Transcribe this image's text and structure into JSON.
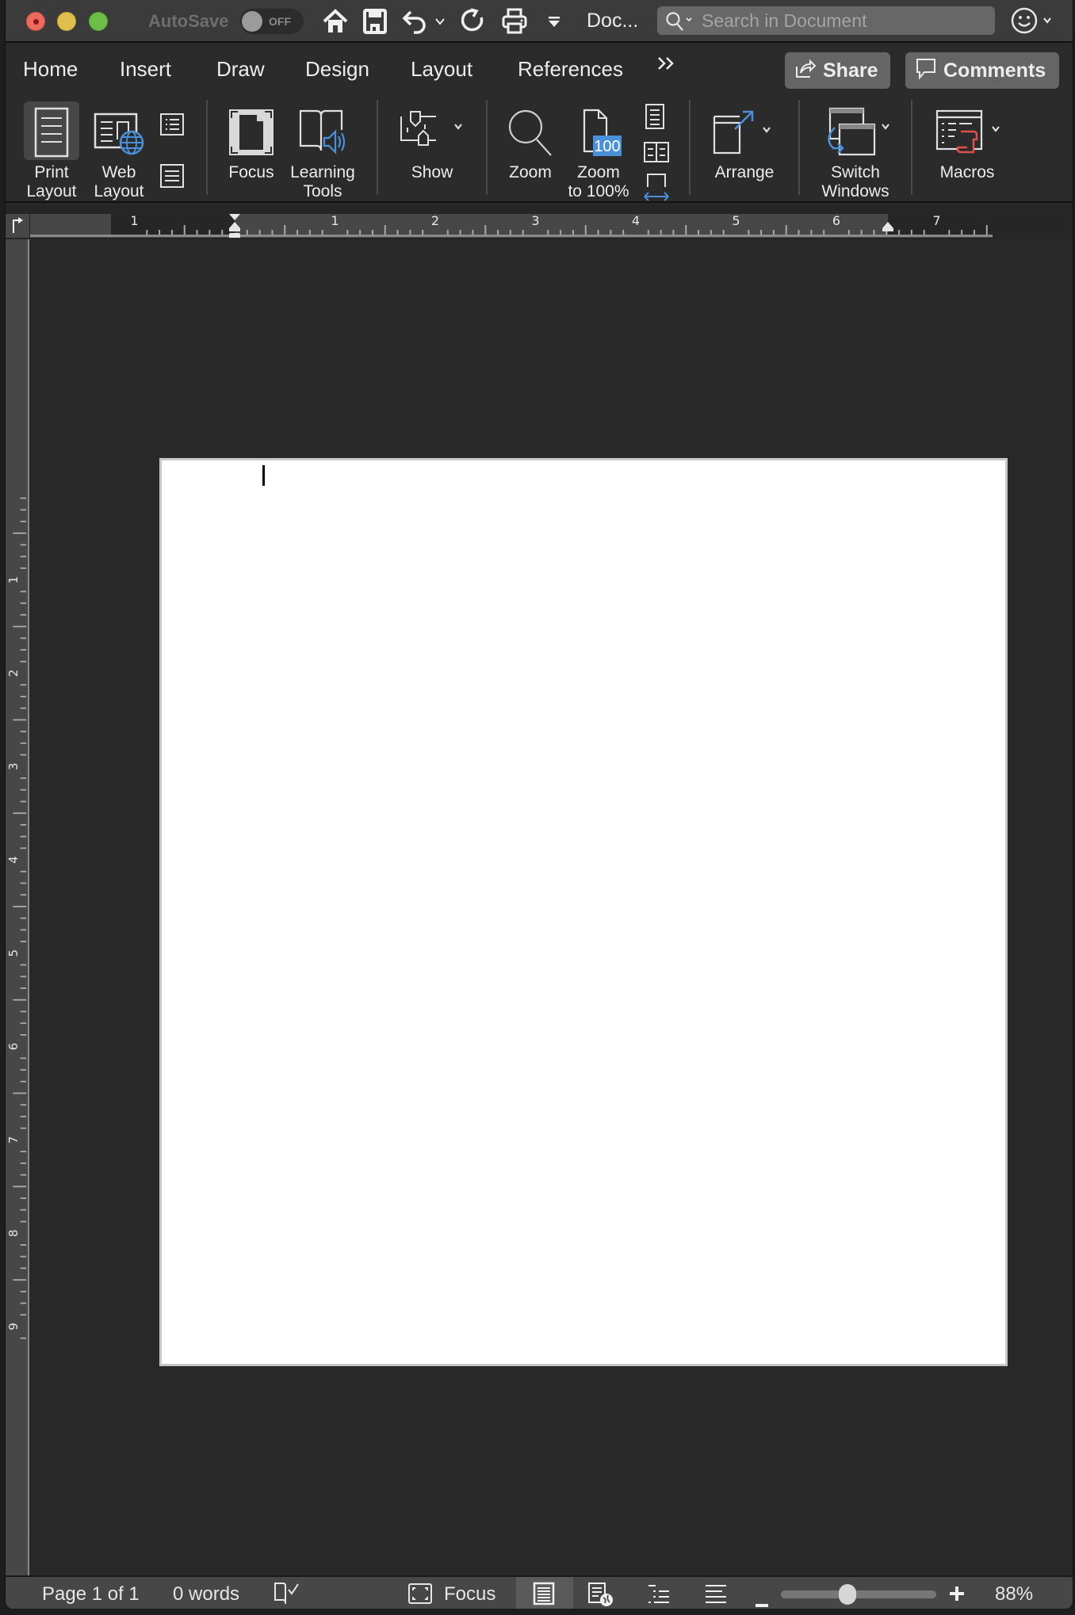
{
  "titlebar": {
    "autosave_label": "AutoSave",
    "autosave_state": "OFF",
    "doc_title": "Doc...",
    "search_placeholder": "Search in Document",
    "icons": [
      "home-icon",
      "save-icon",
      "undo-icon",
      "undo-dropdown-icon",
      "redo-icon",
      "print-icon",
      "customize-toolbar-icon",
      "search-icon",
      "smiley-feedback-icon"
    ]
  },
  "tabs": [
    {
      "label": "Home"
    },
    {
      "label": "Insert"
    },
    {
      "label": "Draw"
    },
    {
      "label": "Design"
    },
    {
      "label": "Layout"
    },
    {
      "label": "References"
    }
  ],
  "tabs_more_label": "»",
  "share_label": "Share",
  "comments_label": "Comments",
  "ribbon": {
    "print_layout": {
      "line1": "Print",
      "line2": "Layout",
      "selected": true
    },
    "web_layout": {
      "line1": "Web",
      "line2": "Layout"
    },
    "focus": {
      "line1": "Focus"
    },
    "learning_tools": {
      "line1": "Learning",
      "line2": "Tools"
    },
    "show": {
      "line1": "Show"
    },
    "zoom": {
      "line1": "Zoom"
    },
    "zoom100": {
      "line1": "Zoom",
      "line2": "to 100%",
      "badge": "100"
    },
    "arrange": {
      "line1": "Arrange"
    },
    "switch_windows": {
      "line1": "Switch",
      "line2": "Windows"
    },
    "macros": {
      "line1": "Macros"
    }
  },
  "hruler": {
    "labels": [
      "1",
      "1",
      "2",
      "3",
      "4",
      "5",
      "6",
      "7"
    ]
  },
  "vruler": {
    "labels": [
      "1",
      "2",
      "3",
      "4",
      "5",
      "6",
      "7",
      "8",
      "9"
    ]
  },
  "status": {
    "page": "Page 1 of 1",
    "words": "0 words",
    "focus_label": "Focus",
    "zoom_percent": "88%",
    "zoom_value": 88
  },
  "colors": {
    "accent_blue": "#4a90d9",
    "macro_red": "#e0504a"
  }
}
